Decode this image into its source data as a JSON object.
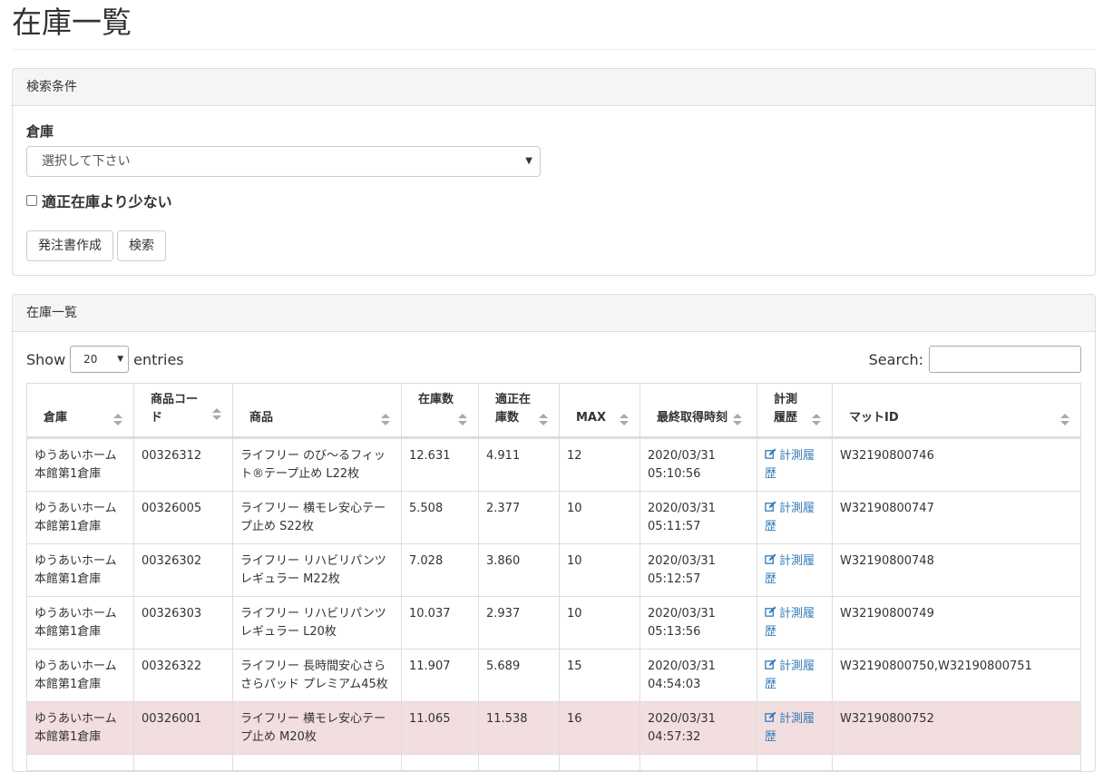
{
  "page": {
    "title": "在庫一覧"
  },
  "search_panel": {
    "heading": "検索条件",
    "warehouse_label": "倉庫",
    "warehouse_select_value": "選択して下さい",
    "checkbox_label": "適正在庫より少ない",
    "order_button": "発注書作成",
    "search_button": "検索"
  },
  "list_panel": {
    "heading": "在庫一覧",
    "show_label": "Show",
    "page_length": "20",
    "entries_label": "entries",
    "search_label": "Search:"
  },
  "table": {
    "columns": [
      "倉庫",
      "商品コード",
      "商品",
      "在庫数",
      "適正在庫数",
      "MAX",
      "最終取得時刻",
      "計測履歴",
      "マットID"
    ],
    "history_link": "計測履歴",
    "rows": [
      {
        "warehouse": "ゆうあいホーム本館第1倉庫",
        "code": "00326312",
        "product": "ライフリー のび～るフィット®テープ止め L22枚",
        "stock": "12.631",
        "proper": "4.911",
        "max": "12",
        "date": "2020/03/31",
        "time": "05:10:56",
        "mat": "W32190800746",
        "highlight": false
      },
      {
        "warehouse": "ゆうあいホーム本館第1倉庫",
        "code": "00326005",
        "product": "ライフリー 横モレ安心テープ止め S22枚",
        "stock": "5.508",
        "proper": "2.377",
        "max": "10",
        "date": "2020/03/31",
        "time": "05:11:57",
        "mat": "W32190800747",
        "highlight": false
      },
      {
        "warehouse": "ゆうあいホーム本館第1倉庫",
        "code": "00326302",
        "product": "ライフリー リハビリパンツ レギュラー M22枚",
        "stock": "7.028",
        "proper": "3.860",
        "max": "10",
        "date": "2020/03/31",
        "time": "05:12:57",
        "mat": "W32190800748",
        "highlight": false
      },
      {
        "warehouse": "ゆうあいホーム本館第1倉庫",
        "code": "00326303",
        "product": "ライフリー リハビリパンツ レギュラー L20枚",
        "stock": "10.037",
        "proper": "2.937",
        "max": "10",
        "date": "2020/03/31",
        "time": "05:13:56",
        "mat": "W32190800749",
        "highlight": false
      },
      {
        "warehouse": "ゆうあいホーム本館第1倉庫",
        "code": "00326322",
        "product": "ライフリー 長時間安心さらさらパッド プレミアム45枚",
        "stock": "11.907",
        "proper": "5.689",
        "max": "15",
        "date": "2020/03/31",
        "time": "04:54:03",
        "mat": "W32190800750,W32190800751",
        "highlight": false
      },
      {
        "warehouse": "ゆうあいホーム本館第1倉庫",
        "code": "00326001",
        "product": "ライフリー 横モレ安心テープ止め M20枚",
        "stock": "11.065",
        "proper": "11.538",
        "max": "16",
        "date": "2020/03/31",
        "time": "04:57:32",
        "mat": "W32190800752",
        "highlight": true
      },
      {
        "warehouse": "",
        "code": "",
        "product": "",
        "stock": "",
        "proper": "",
        "max": "",
        "date": "",
        "time": "",
        "mat": "",
        "highlight": false
      }
    ]
  },
  "colors": {
    "link": "#337ab7",
    "warning_row": "#f2dede",
    "border": "#dddddd",
    "panel_heading": "#f5f5f5"
  }
}
